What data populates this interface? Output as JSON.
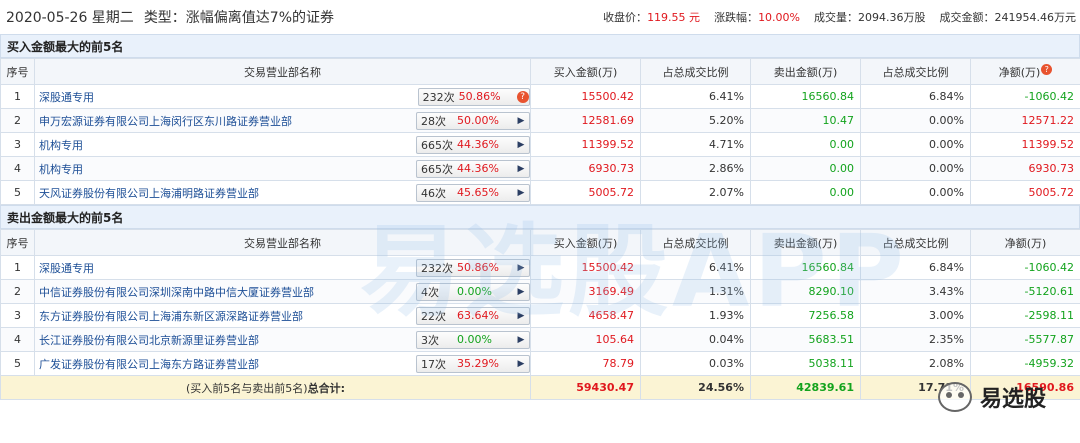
{
  "header": {
    "date": "2020-05-26 星期二",
    "type": "类型：涨幅偏离值达7%的证券",
    "close_label": "收盘价：",
    "close_value": "119.55 元",
    "change_label": "涨跌幅：",
    "change_value": "10.00%",
    "volume": "成交量：2094.36万股",
    "amount": "成交金额：241954.46万元"
  },
  "columns": {
    "idx": "序号",
    "name": "交易营业部名称",
    "buy": "买入金额(万)",
    "buy_ratio": "占总成交比例",
    "sell": "卖出金额(万)",
    "sell_ratio": "占总成交比例",
    "net": "净额(万)"
  },
  "buy_section": {
    "title": "买入金额最大的前5名",
    "rows": [
      {
        "idx": "1",
        "name": "深股通专用",
        "count": "232次",
        "pct": "50.86%",
        "buy": "15500.42",
        "buy_ratio": "6.41%",
        "sell": "16560.84",
        "sell_ratio": "6.84%",
        "net": "-1060.42"
      },
      {
        "idx": "2",
        "name": "申万宏源证券有限公司上海闵行区东川路证券营业部",
        "count": "28次",
        "pct": "50.00%",
        "buy": "12581.69",
        "buy_ratio": "5.20%",
        "sell": "10.47",
        "sell_ratio": "0.00%",
        "net": "12571.22"
      },
      {
        "idx": "3",
        "name": "机构专用",
        "count": "665次",
        "pct": "44.36%",
        "buy": "11399.52",
        "buy_ratio": "4.71%",
        "sell": "0.00",
        "sell_ratio": "0.00%",
        "net": "11399.52"
      },
      {
        "idx": "4",
        "name": "机构专用",
        "count": "665次",
        "pct": "44.36%",
        "buy": "6930.73",
        "buy_ratio": "2.86%",
        "sell": "0.00",
        "sell_ratio": "0.00%",
        "net": "6930.73"
      },
      {
        "idx": "5",
        "name": "天风证券股份有限公司上海浦明路证券营业部",
        "count": "46次",
        "pct": "45.65%",
        "buy": "5005.72",
        "buy_ratio": "2.07%",
        "sell": "0.00",
        "sell_ratio": "0.00%",
        "net": "5005.72"
      }
    ]
  },
  "sell_section": {
    "title": "卖出金额最大的前5名",
    "rows": [
      {
        "idx": "1",
        "name": "深股通专用",
        "count": "232次",
        "pct": "50.86%",
        "buy": "15500.42",
        "buy_ratio": "6.41%",
        "sell": "16560.84",
        "sell_ratio": "6.84%",
        "net": "-1060.42"
      },
      {
        "idx": "2",
        "name": "中信证券股份有限公司深圳深南中路中信大厦证券营业部",
        "count": "4次",
        "pct": "0.00%",
        "buy": "3169.49",
        "buy_ratio": "1.31%",
        "sell": "8290.10",
        "sell_ratio": "3.43%",
        "net": "-5120.61"
      },
      {
        "idx": "3",
        "name": "东方证券股份有限公司上海浦东新区源深路证券营业部",
        "count": "22次",
        "pct": "63.64%",
        "buy": "4658.47",
        "buy_ratio": "1.93%",
        "sell": "7256.58",
        "sell_ratio": "3.00%",
        "net": "-2598.11"
      },
      {
        "idx": "4",
        "name": "长江证券股份有限公司北京新源里证券营业部",
        "count": "3次",
        "pct": "0.00%",
        "buy": "105.64",
        "buy_ratio": "0.04%",
        "sell": "5683.51",
        "sell_ratio": "2.35%",
        "net": "-5577.87"
      },
      {
        "idx": "5",
        "name": "广发证券股份有限公司上海东方路证券营业部",
        "count": "17次",
        "pct": "35.29%",
        "buy": "78.79",
        "buy_ratio": "0.03%",
        "sell": "5038.11",
        "sell_ratio": "2.08%",
        "net": "-4959.32"
      }
    ]
  },
  "total": {
    "label_prefix": "(买入前5名与卖出前5名)",
    "label_bold": "总合计:",
    "buy": "59430.47",
    "buy_ratio": "24.56%",
    "sell": "42839.61",
    "sell_ratio": "17.71%",
    "net": "16590.86"
  },
  "watermark": {
    "main": "易选股APP",
    "brand": "易选股"
  },
  "colors": {
    "up": "#e0181e",
    "down": "#13a31d",
    "link": "#1c4e96"
  },
  "icons": {
    "question": "question-icon",
    "arrow": "play-arrow-icon"
  }
}
